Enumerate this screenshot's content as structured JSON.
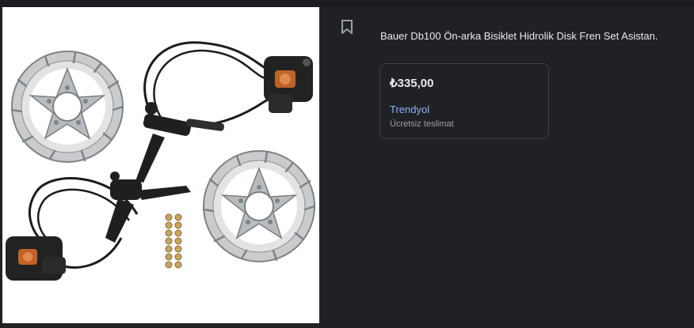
{
  "product": {
    "title": "Bauer Db100 Ön-arka Bisiklet Hidrolik Disk Fren Set Asistan.",
    "image_icon": "bicycle-hydraulic-disc-brake-set"
  },
  "actions": {
    "bookmark_icon": "bookmark-icon"
  },
  "offer": {
    "price": "₺335,00",
    "merchant": "Trendyol",
    "shipping": "Ücretsiz teslimat"
  },
  "colors": {
    "background": "#202124",
    "title_text": "#e8eaed",
    "merchant_link": "#8ab4f8",
    "secondary_text": "#9aa0a6",
    "card_border": "#3c4043"
  }
}
